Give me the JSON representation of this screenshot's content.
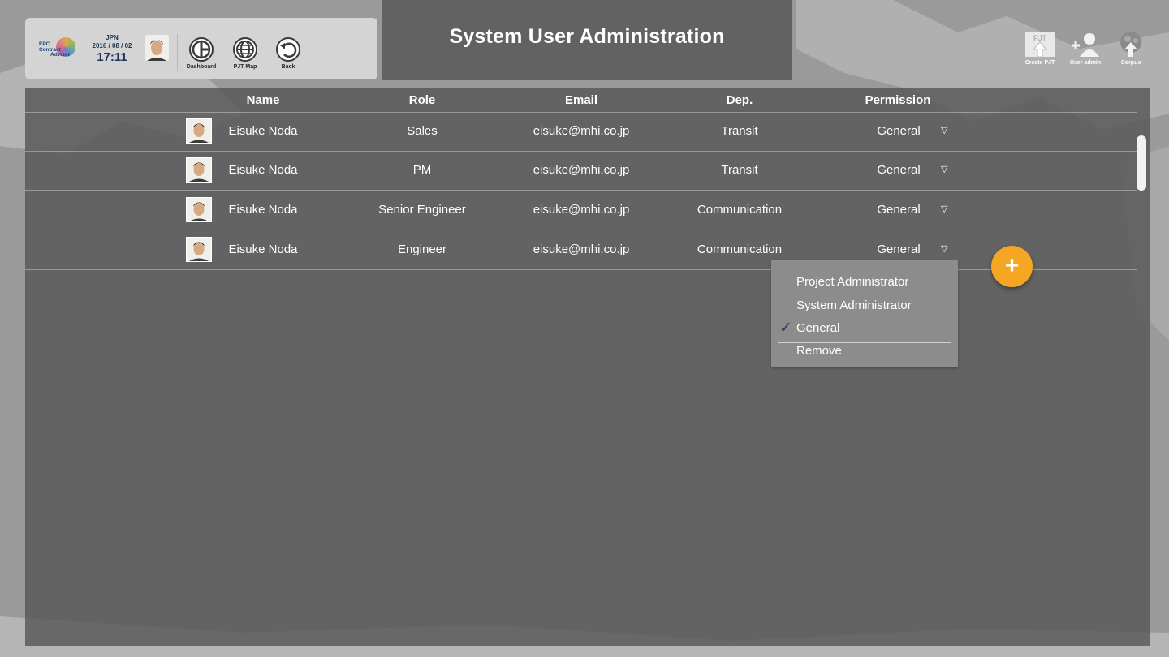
{
  "header": {
    "title": "System User Administration",
    "logo_lines": [
      "EPC",
      "Contract",
      "Advisor"
    ],
    "country": "JPN",
    "date": "2016 / 08 / 02",
    "time": "17:11",
    "nav": [
      {
        "label": "Dashboard",
        "icon": "dashboard-icon"
      },
      {
        "label": "PJT Map",
        "icon": "globe-icon"
      },
      {
        "label": "Back",
        "icon": "back-arrow-icon"
      }
    ],
    "tools": [
      {
        "label": "Create PJT",
        "icon": "create-project-icon",
        "badge": "PJT"
      },
      {
        "label": "User admin",
        "icon": "add-user-icon"
      },
      {
        "label": "Corpus",
        "icon": "corpus-upload-icon"
      }
    ]
  },
  "table": {
    "columns": [
      "Name",
      "Role",
      "Email",
      "Dep.",
      "Permission"
    ],
    "rows": [
      {
        "name": "Eisuke Noda",
        "role": "Sales",
        "email": "eisuke@mhi.co.jp",
        "dep": "Transit",
        "permission": "General"
      },
      {
        "name": "Eisuke Noda",
        "role": "PM",
        "email": "eisuke@mhi.co.jp",
        "dep": "Transit",
        "permission": "General"
      },
      {
        "name": "Eisuke Noda",
        "role": "Senior Engineer",
        "email": "eisuke@mhi.co.jp",
        "dep": "Communication",
        "permission": "General"
      },
      {
        "name": "Eisuke Noda",
        "role": "Engineer",
        "email": "eisuke@mhi.co.jp",
        "dep": "Communication",
        "permission": "General"
      }
    ],
    "arrow_glyph": "▽"
  },
  "dropdown": {
    "options": [
      "Project Administrator",
      "System Administrator",
      "General"
    ],
    "selected": "General",
    "check_glyph": "✓",
    "remove_label": "Remove"
  },
  "fab": {
    "glyph": "+",
    "icon": "add-icon",
    "color": "#f5a623"
  },
  "colors": {
    "panel": "#585858",
    "title_block": "#626262",
    "accent": "#f5a623",
    "text_dark": "#1c3557"
  }
}
